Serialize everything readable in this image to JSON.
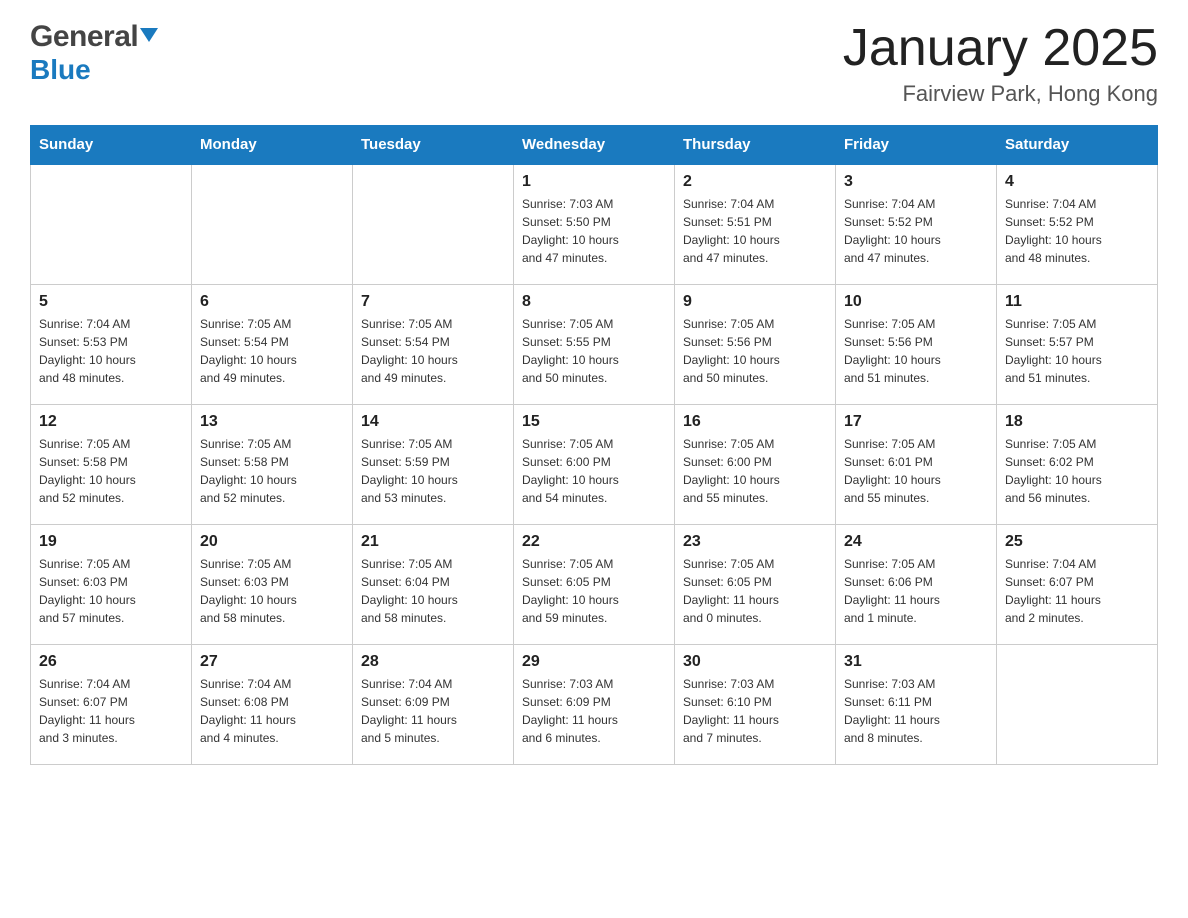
{
  "header": {
    "logo_general": "General",
    "logo_blue": "Blue",
    "title": "January 2025",
    "subtitle": "Fairview Park, Hong Kong"
  },
  "days_of_week": [
    "Sunday",
    "Monday",
    "Tuesday",
    "Wednesday",
    "Thursday",
    "Friday",
    "Saturday"
  ],
  "weeks": [
    [
      {
        "day": "",
        "info": ""
      },
      {
        "day": "",
        "info": ""
      },
      {
        "day": "",
        "info": ""
      },
      {
        "day": "1",
        "info": "Sunrise: 7:03 AM\nSunset: 5:50 PM\nDaylight: 10 hours\nand 47 minutes."
      },
      {
        "day": "2",
        "info": "Sunrise: 7:04 AM\nSunset: 5:51 PM\nDaylight: 10 hours\nand 47 minutes."
      },
      {
        "day": "3",
        "info": "Sunrise: 7:04 AM\nSunset: 5:52 PM\nDaylight: 10 hours\nand 47 minutes."
      },
      {
        "day": "4",
        "info": "Sunrise: 7:04 AM\nSunset: 5:52 PM\nDaylight: 10 hours\nand 48 minutes."
      }
    ],
    [
      {
        "day": "5",
        "info": "Sunrise: 7:04 AM\nSunset: 5:53 PM\nDaylight: 10 hours\nand 48 minutes."
      },
      {
        "day": "6",
        "info": "Sunrise: 7:05 AM\nSunset: 5:54 PM\nDaylight: 10 hours\nand 49 minutes."
      },
      {
        "day": "7",
        "info": "Sunrise: 7:05 AM\nSunset: 5:54 PM\nDaylight: 10 hours\nand 49 minutes."
      },
      {
        "day": "8",
        "info": "Sunrise: 7:05 AM\nSunset: 5:55 PM\nDaylight: 10 hours\nand 50 minutes."
      },
      {
        "day": "9",
        "info": "Sunrise: 7:05 AM\nSunset: 5:56 PM\nDaylight: 10 hours\nand 50 minutes."
      },
      {
        "day": "10",
        "info": "Sunrise: 7:05 AM\nSunset: 5:56 PM\nDaylight: 10 hours\nand 51 minutes."
      },
      {
        "day": "11",
        "info": "Sunrise: 7:05 AM\nSunset: 5:57 PM\nDaylight: 10 hours\nand 51 minutes."
      }
    ],
    [
      {
        "day": "12",
        "info": "Sunrise: 7:05 AM\nSunset: 5:58 PM\nDaylight: 10 hours\nand 52 minutes."
      },
      {
        "day": "13",
        "info": "Sunrise: 7:05 AM\nSunset: 5:58 PM\nDaylight: 10 hours\nand 52 minutes."
      },
      {
        "day": "14",
        "info": "Sunrise: 7:05 AM\nSunset: 5:59 PM\nDaylight: 10 hours\nand 53 minutes."
      },
      {
        "day": "15",
        "info": "Sunrise: 7:05 AM\nSunset: 6:00 PM\nDaylight: 10 hours\nand 54 minutes."
      },
      {
        "day": "16",
        "info": "Sunrise: 7:05 AM\nSunset: 6:00 PM\nDaylight: 10 hours\nand 55 minutes."
      },
      {
        "day": "17",
        "info": "Sunrise: 7:05 AM\nSunset: 6:01 PM\nDaylight: 10 hours\nand 55 minutes."
      },
      {
        "day": "18",
        "info": "Sunrise: 7:05 AM\nSunset: 6:02 PM\nDaylight: 10 hours\nand 56 minutes."
      }
    ],
    [
      {
        "day": "19",
        "info": "Sunrise: 7:05 AM\nSunset: 6:03 PM\nDaylight: 10 hours\nand 57 minutes."
      },
      {
        "day": "20",
        "info": "Sunrise: 7:05 AM\nSunset: 6:03 PM\nDaylight: 10 hours\nand 58 minutes."
      },
      {
        "day": "21",
        "info": "Sunrise: 7:05 AM\nSunset: 6:04 PM\nDaylight: 10 hours\nand 58 minutes."
      },
      {
        "day": "22",
        "info": "Sunrise: 7:05 AM\nSunset: 6:05 PM\nDaylight: 10 hours\nand 59 minutes."
      },
      {
        "day": "23",
        "info": "Sunrise: 7:05 AM\nSunset: 6:05 PM\nDaylight: 11 hours\nand 0 minutes."
      },
      {
        "day": "24",
        "info": "Sunrise: 7:05 AM\nSunset: 6:06 PM\nDaylight: 11 hours\nand 1 minute."
      },
      {
        "day": "25",
        "info": "Sunrise: 7:04 AM\nSunset: 6:07 PM\nDaylight: 11 hours\nand 2 minutes."
      }
    ],
    [
      {
        "day": "26",
        "info": "Sunrise: 7:04 AM\nSunset: 6:07 PM\nDaylight: 11 hours\nand 3 minutes."
      },
      {
        "day": "27",
        "info": "Sunrise: 7:04 AM\nSunset: 6:08 PM\nDaylight: 11 hours\nand 4 minutes."
      },
      {
        "day": "28",
        "info": "Sunrise: 7:04 AM\nSunset: 6:09 PM\nDaylight: 11 hours\nand 5 minutes."
      },
      {
        "day": "29",
        "info": "Sunrise: 7:03 AM\nSunset: 6:09 PM\nDaylight: 11 hours\nand 6 minutes."
      },
      {
        "day": "30",
        "info": "Sunrise: 7:03 AM\nSunset: 6:10 PM\nDaylight: 11 hours\nand 7 minutes."
      },
      {
        "day": "31",
        "info": "Sunrise: 7:03 AM\nSunset: 6:11 PM\nDaylight: 11 hours\nand 8 minutes."
      },
      {
        "day": "",
        "info": ""
      }
    ]
  ]
}
